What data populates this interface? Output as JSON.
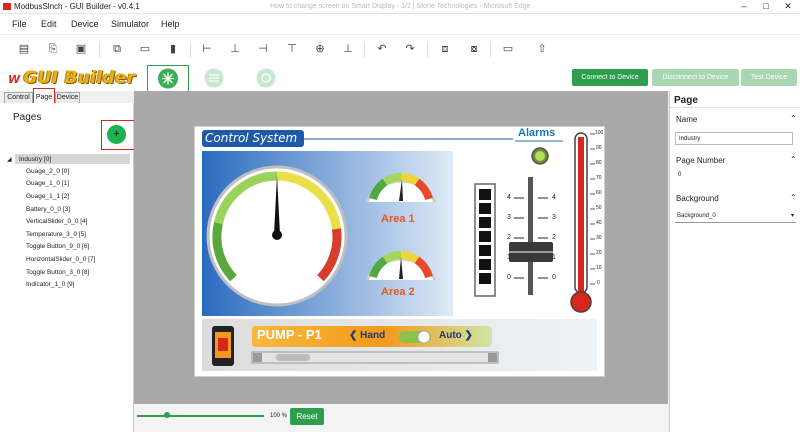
{
  "window": {
    "title": "ModbusSlnch - GUI Builder - v0.4.1",
    "faded_tab": "How to change screen on Smart Display - 1/2 | Stone Technologies - Microsoft Edge"
  },
  "menu": [
    "File",
    "Edit",
    "Device",
    "Simulator",
    "Help"
  ],
  "brand": {
    "logo_text": "GUI Builder"
  },
  "actions": {
    "connect": "Connect to Device",
    "disconnect": "Disconnect to Device",
    "test": "Test Device"
  },
  "left_tabs": [
    "Control",
    "Page",
    "Device"
  ],
  "pages": {
    "heading": "Pages",
    "add_label": "+",
    "tree": [
      "Industry [0]",
      "Guage_2_0 [0]",
      "Guage_1_0 [1]",
      "Guage_1_1 [2]",
      "Battery_0_0 [3]",
      "VerticalSlider_0_0 [4]",
      "Temperature_3_0 [5]",
      "Toggle Button_9_0 [6]",
      "HorizontalSlider_0_0 [7]",
      "Toggle Button_3_0 [8]",
      "Indicator_1_0 [9]"
    ]
  },
  "hmi": {
    "banner": "Control System",
    "alarms": "Alarms",
    "area1": "Area 1",
    "area2": "Area 2",
    "pump": "PUMP - P1",
    "hand": "Hand",
    "auto": "Auto",
    "slider_scale": [
      "4",
      "3",
      "2",
      "1",
      "0"
    ],
    "thermo_scale": [
      "100",
      "90",
      "80",
      "70",
      "60",
      "50",
      "40",
      "30",
      "20",
      "10",
      "0"
    ]
  },
  "properties": {
    "title": "Page",
    "name_label": "Name",
    "name_value": "Industry",
    "page_number_label": "Page Number",
    "page_number_value": "0",
    "background_label": "Background",
    "background_value": "Background_0"
  },
  "zoom": {
    "value_label": "100 %",
    "reset": "Reset",
    "fraction": 0.24
  },
  "colors": {
    "accent_green": "#2e9d4e",
    "banner_blue": "#1e5aa8",
    "alarm_blue": "#1a73b5",
    "pump_orange": "#f39a1b"
  }
}
